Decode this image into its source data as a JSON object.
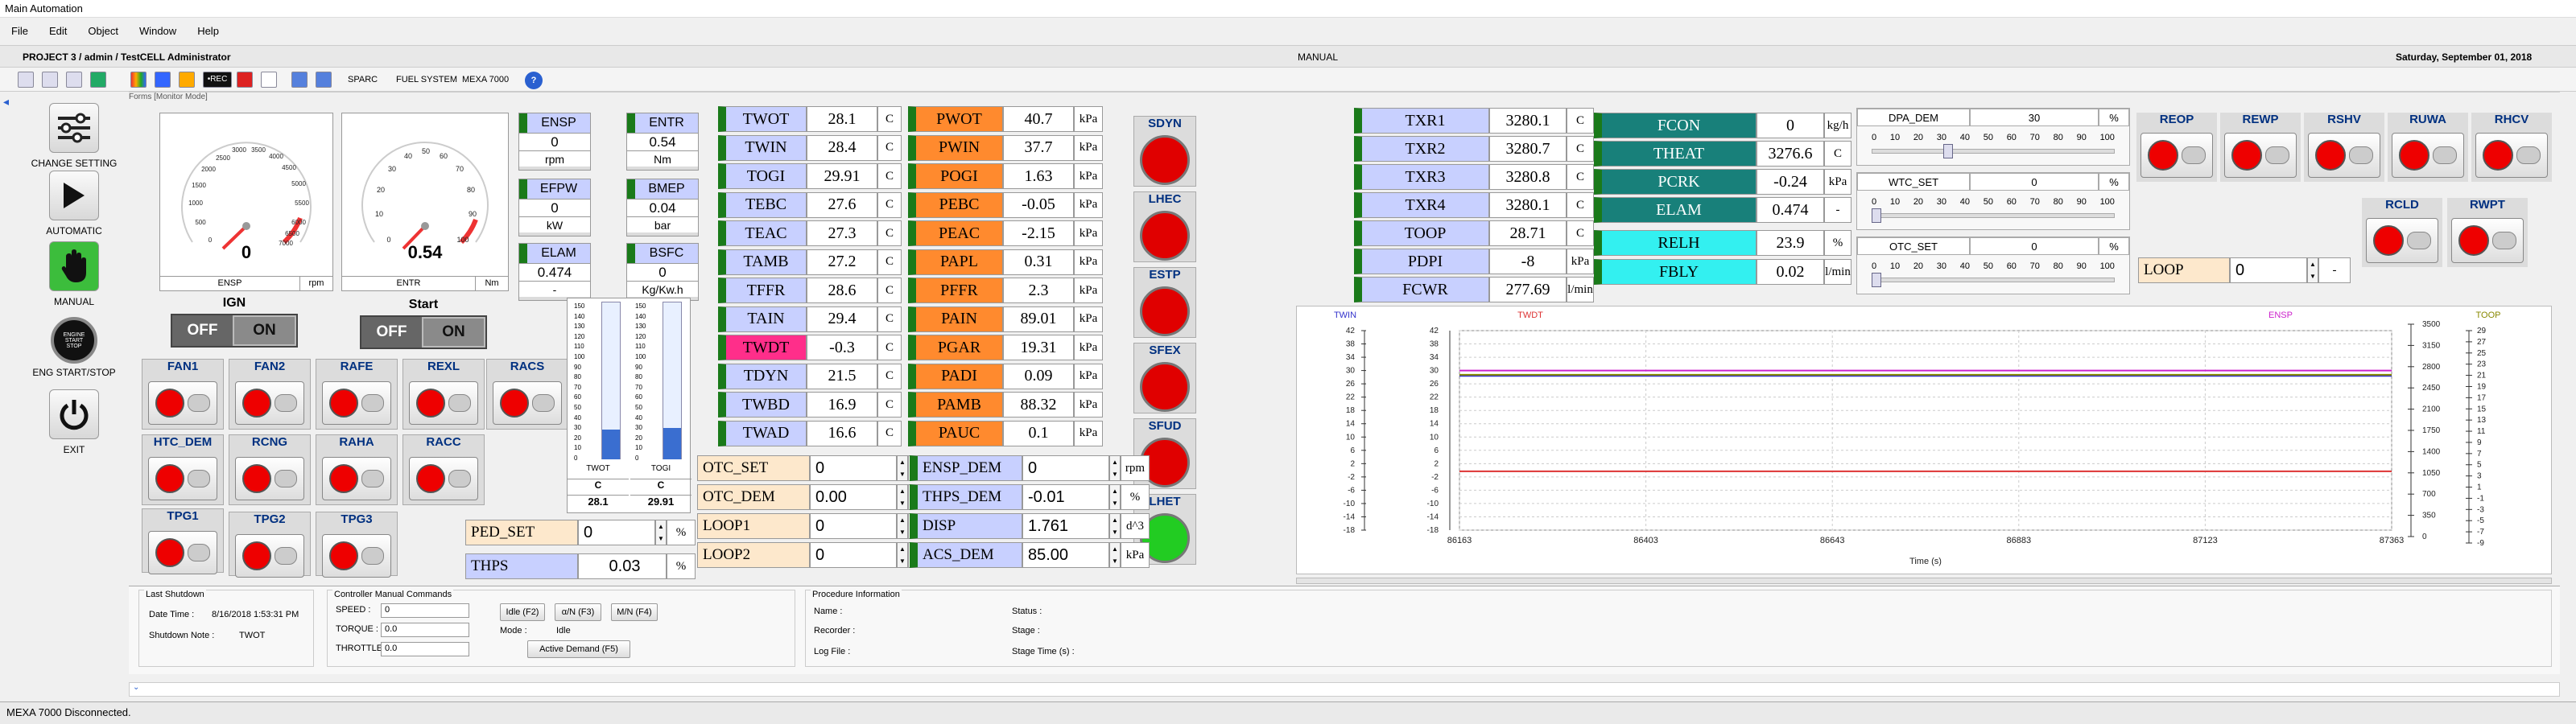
{
  "window": {
    "title": "Main Automation"
  },
  "menu": [
    "File",
    "Edit",
    "Object",
    "Window",
    "Help"
  ],
  "info": {
    "project": "PROJECT 3 / admin / TestCELL Administrator",
    "mode": "MANUAL",
    "date": "Saturday, September 01, 2018"
  },
  "toolbar": {
    "sparc": "SPARC",
    "fuel": "FUEL SYSTEM",
    "mexa": "MEXA 7000",
    "rec": "•REC"
  },
  "frame_title": "Forms [Monitor Mode]",
  "nav": [
    {
      "label": "CHANGE SETTING",
      "icon": "sliders-icon"
    },
    {
      "label": "AUTOMATIC",
      "icon": "play-icon"
    },
    {
      "label": "MANUAL",
      "icon": "hand-icon"
    },
    {
      "label": "ENG START/STOP",
      "icon": "engine-button-icon"
    },
    {
      "label": "EXIT",
      "icon": "power-icon"
    }
  ],
  "gauges": [
    {
      "name": "ENSP",
      "unit": "rpm",
      "value": "0",
      "scale": [
        "0",
        "500",
        "1000",
        "1500",
        "2000",
        "2500",
        "3000",
        "3500",
        "4000",
        "4500",
        "5000",
        "5500",
        "6000",
        "6500",
        "7000"
      ]
    },
    {
      "name": "ENTR",
      "unit": "Nm",
      "value": "0.54",
      "scale": [
        "0",
        "10",
        "20",
        "30",
        "40",
        "50",
        "60",
        "70",
        "80",
        "90",
        "100"
      ]
    }
  ],
  "toggles": [
    {
      "label": "IGN",
      "off": "OFF",
      "on": "ON"
    },
    {
      "label": "Start",
      "off": "OFF",
      "on": "ON"
    }
  ],
  "tiles": [
    {
      "name": "ENSP",
      "value": "0",
      "unit": "rpm"
    },
    {
      "name": "ENTR",
      "value": "0.54",
      "unit": "Nm"
    },
    {
      "name": "EFPW",
      "value": "0",
      "unit": "kW"
    },
    {
      "name": "BMEP",
      "value": "0.04",
      "unit": "bar"
    },
    {
      "name": "ELAM",
      "value": "0.474",
      "unit": "-"
    },
    {
      "name": "BSFC",
      "value": "0",
      "unit": "Kg/Kw.h"
    }
  ],
  "switch_lamps": [
    "FAN1",
    "FAN2",
    "RAFE",
    "REXL",
    "RACS",
    "HTC_DEM",
    "RCNG",
    "RAHA",
    "RACC",
    "TPG1",
    "TPG2",
    "TPG3"
  ],
  "bargraphs": [
    {
      "name": "TWOT",
      "unit": "C",
      "value": "28.1",
      "scale": [
        "150",
        "140",
        "130",
        "120",
        "110",
        "100",
        "90",
        "80",
        "70",
        "60",
        "50",
        "40",
        "30",
        "20",
        "10",
        "0"
      ],
      "level": 0.19
    },
    {
      "name": "TOGI",
      "unit": "C",
      "value": "29.91",
      "scale": [
        "150",
        "140",
        "130",
        "120",
        "110",
        "100",
        "90",
        "80",
        "70",
        "60",
        "50",
        "40",
        "30",
        "20",
        "10",
        "0"
      ],
      "level": 0.2
    }
  ],
  "temps": [
    {
      "name": "TWOT",
      "value": "28.1",
      "unit": "C",
      "color": "#c8d0ff"
    },
    {
      "name": "TWIN",
      "value": "28.4",
      "unit": "C",
      "color": "#c8d0ff"
    },
    {
      "name": "TOGI",
      "value": "29.91",
      "unit": "C",
      "color": "#c8d0ff"
    },
    {
      "name": "TEBC",
      "value": "27.6",
      "unit": "C",
      "color": "#c8d0ff"
    },
    {
      "name": "TEAC",
      "value": "27.3",
      "unit": "C",
      "color": "#c8d0ff"
    },
    {
      "name": "TAMB",
      "value": "27.2",
      "unit": "C",
      "color": "#c8d0ff"
    },
    {
      "name": "TFFR",
      "value": "28.6",
      "unit": "C",
      "color": "#c8d0ff"
    },
    {
      "name": "TAIN",
      "value": "29.4",
      "unit": "C",
      "color": "#c8d0ff"
    },
    {
      "name": "TWDT",
      "value": "-0.3",
      "unit": "C",
      "color": "#ff2e8a"
    },
    {
      "name": "TDYN",
      "value": "21.5",
      "unit": "C",
      "color": "#c8d0ff"
    },
    {
      "name": "TWBD",
      "value": "16.9",
      "unit": "C",
      "color": "#c8d0ff"
    },
    {
      "name": "TWAD",
      "value": "16.6",
      "unit": "C",
      "color": "#c8d0ff"
    }
  ],
  "pressures": [
    {
      "name": "PWOT",
      "value": "40.7",
      "unit": "kPa"
    },
    {
      "name": "PWIN",
      "value": "37.7",
      "unit": "kPa"
    },
    {
      "name": "POGI",
      "value": "1.63",
      "unit": "kPa"
    },
    {
      "name": "PEBC",
      "value": "-0.05",
      "unit": "kPa"
    },
    {
      "name": "PEAC",
      "value": "-2.15",
      "unit": "kPa"
    },
    {
      "name": "PAPL",
      "value": "0.31",
      "unit": "kPa"
    },
    {
      "name": "PFFR",
      "value": "2.3",
      "unit": "kPa"
    },
    {
      "name": "PAIN",
      "value": "89.01",
      "unit": "kPa"
    },
    {
      "name": "PGAR",
      "value": "19.31",
      "unit": "kPa"
    },
    {
      "name": "PADI",
      "value": "0.09",
      "unit": "kPa"
    },
    {
      "name": "PAMB",
      "value": "88.32",
      "unit": "kPa"
    },
    {
      "name": "PAUC",
      "value": "0.1",
      "unit": "kPa"
    }
  ],
  "lamps": [
    {
      "name": "SDYN",
      "color": "#e00000"
    },
    {
      "name": "LHEC",
      "color": "#e00000"
    },
    {
      "name": "ESTP",
      "color": "#e00000"
    },
    {
      "name": "SFEX",
      "color": "#e00000"
    },
    {
      "name": "SFUD",
      "color": "#e00000"
    },
    {
      "name": "LHET",
      "color": "#22cc22"
    }
  ],
  "setpoints_left": [
    {
      "name": "OTC_SET",
      "value": "0",
      "unit": "%"
    },
    {
      "name": "OTC_DEM",
      "value": "0.00",
      "unit": "%"
    },
    {
      "name": "LOOP1",
      "value": "0",
      "unit": "-"
    },
    {
      "name": "LOOP2",
      "value": "0",
      "unit": "-"
    }
  ],
  "setpoints_mid": [
    {
      "name": "ENSP_DEM",
      "value": "0",
      "unit": "rpm"
    },
    {
      "name": "THPS_DEM",
      "value": "-0.01",
      "unit": "%"
    },
    {
      "name": "DISP",
      "value": "1.761",
      "unit": "d^3"
    },
    {
      "name": "ACS_DEM",
      "value": "85.00",
      "unit": "kPa"
    }
  ],
  "ped_set": {
    "name": "PED_SET",
    "value": "0",
    "unit": "%"
  },
  "thps": {
    "name": "THPS",
    "value": "0.03",
    "unit": "%"
  },
  "tx": [
    {
      "name": "TXR1",
      "value": "3280.1",
      "unit": "C"
    },
    {
      "name": "TXR2",
      "value": "3280.7",
      "unit": "C"
    },
    {
      "name": "TXR3",
      "value": "3280.8",
      "unit": "C"
    },
    {
      "name": "TXR4",
      "value": "3280.1",
      "unit": "C"
    },
    {
      "name": "TOOP",
      "value": "28.71",
      "unit": "C"
    },
    {
      "name": "PDPI",
      "value": "-8",
      "unit": "kPa"
    },
    {
      "name": "FCWR",
      "value": "277.69",
      "unit": "l/min"
    }
  ],
  "fuel": [
    {
      "name": "FCON",
      "value": "0",
      "unit": "kg/h"
    },
    {
      "name": "THEAT",
      "value": "3276.6",
      "unit": "C"
    },
    {
      "name": "PCRK",
      "value": "-0.24",
      "unit": "kPa"
    },
    {
      "name": "ELAM",
      "value": "0.474",
      "unit": "-"
    }
  ],
  "humid": [
    {
      "name": "RELH",
      "value": "23.9",
      "unit": "%"
    },
    {
      "name": "FBLY",
      "value": "0.02",
      "unit": "l/min"
    }
  ],
  "sliders": [
    {
      "name": "DPA_DEM",
      "value": "30",
      "unit": "%",
      "level": 0.3
    },
    {
      "name": "WTC_SET",
      "value": "0",
      "unit": "%",
      "level": 0.0
    },
    {
      "name": "OTC_SET",
      "value": "0",
      "unit": "%",
      "level": 0.0
    }
  ],
  "slider_scale": [
    "0",
    "10",
    "20",
    "30",
    "40",
    "50",
    "60",
    "70",
    "80",
    "90",
    "100"
  ],
  "right_switches": [
    "REOP",
    "REWP",
    "RSHV",
    "RUWA",
    "RHCV",
    "RCLD",
    "RWPT"
  ],
  "loop": {
    "name": "LOOP",
    "value": "0",
    "unit": "-"
  },
  "chart_data": {
    "type": "line",
    "series": [
      {
        "name": "TWIN",
        "color": "#3333cc",
        "values": [
          28.4,
          28.4
        ]
      },
      {
        "name": "TWDT",
        "color": "#dd3333",
        "values": [
          -0.3,
          -0.3
        ]
      },
      {
        "name": "ENSP",
        "color": "#cc22cc",
        "values": [
          0,
          0
        ]
      },
      {
        "name": "TOOP",
        "color": "#888800",
        "values": [
          28.71,
          28.71
        ]
      }
    ],
    "x": [
      86163,
      87363
    ],
    "xticks": [
      "86163",
      "86403",
      "86643",
      "86883",
      "87123",
      "87363"
    ],
    "xlabel": "Time (s)",
    "left_ticks_1": [
      "42",
      "38",
      "34",
      "30",
      "26",
      "22",
      "18",
      "14",
      "10",
      "6",
      "2",
      "-2",
      "-6",
      "-10",
      "-14",
      "-18"
    ],
    "left_ticks_2": [
      "42",
      "38",
      "34",
      "30",
      "26",
      "22",
      "18",
      "14",
      "10",
      "6",
      "2",
      "-2",
      "-6",
      "-10",
      "-14",
      "-18"
    ],
    "right_ticks_1": [
      "3500",
      "3150",
      "2800",
      "2450",
      "2100",
      "1750",
      "1400",
      "1050",
      "700",
      "350",
      "0"
    ],
    "right_ticks_2": [
      "29",
      "27",
      "25",
      "23",
      "21",
      "19",
      "17",
      "15",
      "13",
      "11",
      "9",
      "7",
      "5",
      "3",
      "1",
      "-1",
      "-3",
      "-5",
      "-7",
      "-9"
    ],
    "ylim_left": [
      -18,
      42
    ],
    "grid": true
  },
  "bottom": {
    "last_shutdown": {
      "title": "Last Shutdown",
      "date_label": "Date Time :",
      "date": "8/16/2018 1:53:31 PM",
      "note_label": "Shutdown Note :",
      "note": "TWOT"
    },
    "manual": {
      "title": "Controller Manual Commands",
      "speed_label": "SPEED :",
      "speed": "0",
      "torque_label": "TORQUE :",
      "torque": "0.0",
      "throttle_label": "THROTTLE :",
      "throttle": "0.0",
      "idle": "Idle (F2)",
      "an": "α/N (F3)",
      "mn": "M/N (F4)",
      "mode_label": "Mode :",
      "mode": "Idle",
      "active": "Active Demand (F5)"
    },
    "procedure": {
      "title": "Procedure Information",
      "name": "Name :",
      "recorder": "Recorder :",
      "logfile": "Log File :",
      "status": "Status :",
      "stage": "Stage :",
      "stage_time": "Stage Time (s) :"
    }
  },
  "status": "MEXA 7000 Disconnected."
}
